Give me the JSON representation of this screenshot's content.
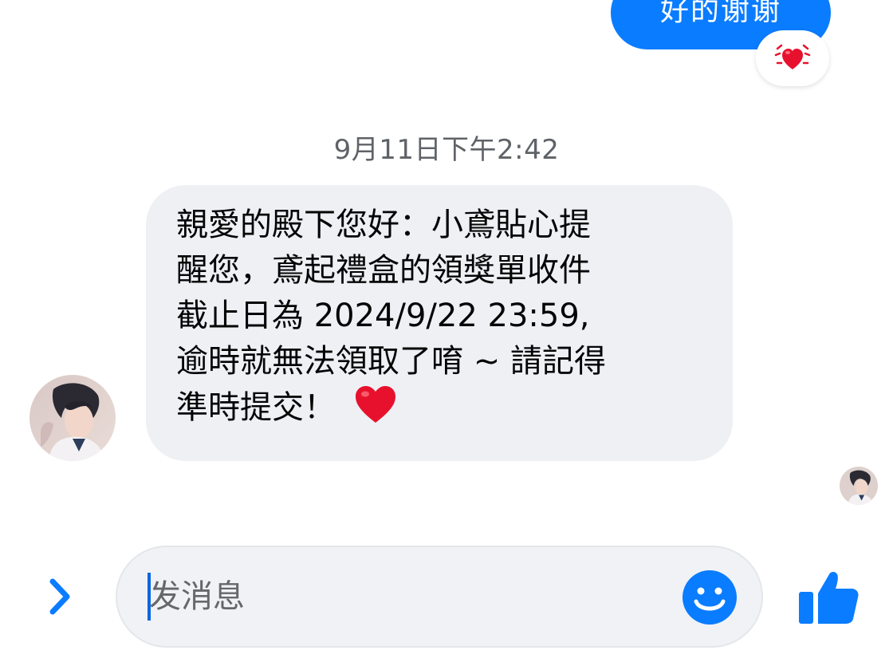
{
  "thread": {
    "outgoing_message": "好的谢谢",
    "reaction_emoji": "heart-beating-icon",
    "timestamp": "9月11日下午2:42",
    "incoming_message_lines": [
      "親愛的殿下您好：小鳶貼心提",
      "醒您，鳶起禮盒的領獎單收件",
      "截止日為 2024/9/22 23:59,",
      "逾時就無法領取了唷 ~ 請記得",
      "準時提交！"
    ],
    "incoming_emoji": "red-heart-icon"
  },
  "composer": {
    "placeholder": "发消息",
    "value": ""
  },
  "icons": {
    "expand": "chevron-right-icon",
    "emoji": "smiley-icon",
    "like": "thumbs-up-icon"
  },
  "colors": {
    "accent": "#0a7cff",
    "incoming_bubble": "#eef0f4",
    "heart": "#e8112d"
  }
}
